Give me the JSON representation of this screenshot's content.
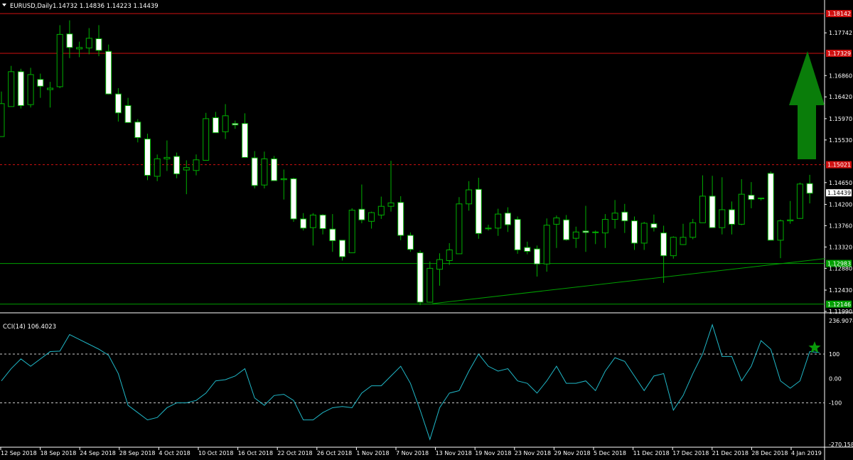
{
  "header": {
    "symbol": "EURUSD,Daily",
    "ohlc": "1.14732 1.14836 1.14223 1.14439"
  },
  "colors": {
    "background": "#000000",
    "bull_fill": "#000000",
    "bull_stroke": "#00b000",
    "bear_fill": "#ffffff",
    "resistance": "#d01010",
    "support": "#00a000",
    "cci_line": "#20b8c8",
    "arrow": "#0a7d0a",
    "star": "#0a9a0a"
  },
  "icons": {
    "arrow": "up-arrow-icon",
    "star": "star-icon",
    "menu": "triangle-down-icon"
  },
  "chart_data": [
    {
      "type": "candlestick",
      "ylim": [
        1.1199,
        1.182
      ],
      "price_ticks": [
        "1.17742",
        "1.16860",
        "1.16420",
        "1.15970",
        "1.15530",
        "1.14650",
        "1.14200",
        "1.13760",
        "1.13320",
        "1.12880",
        "1.12430",
        "1.11990"
      ],
      "x_labels": [
        "12 Sep 2018",
        "18 Sep 2018",
        "24 Sep 2018",
        "28 Sep 2018",
        "4 Oct 2018",
        "10 Oct 2018",
        "16 Oct 2018",
        "22 Oct 2018",
        "26 Oct 2018",
        "1 Nov 2018",
        "7 Nov 2018",
        "13 Nov 2018",
        "19 Nov 2018",
        "23 Nov 2018",
        "29 Nov 2018",
        "5 Dec 2018",
        "11 Dec 2018",
        "17 Dec 2018",
        "21 Dec 2018",
        "28 Dec 2018",
        "4 Jan 2019"
      ],
      "current_price": "1.14439",
      "horizontal_levels": [
        {
          "value": 1.1814,
          "label": "1.18142",
          "color": "#d01010",
          "style": "solid"
        },
        {
          "value": 1.1732,
          "label": "1.17329",
          "color": "#d01010",
          "style": "solid"
        },
        {
          "value": 1.1502,
          "label": "1.15021",
          "color": "#d01010",
          "style": "dashed"
        },
        {
          "value": 1.1298,
          "label": "1.12983",
          "color": "#00a000",
          "style": "solid"
        },
        {
          "value": 1.1214,
          "label": "1.12146",
          "color": "#00a000",
          "style": "solid"
        }
      ],
      "trendline": {
        "from": [
          1.1215
        ],
        "to": [
          1.1308
        ]
      },
      "candles": [
        [
          1.156,
          1.1653,
          1.1583,
          1.1628
        ],
        [
          1.1622,
          1.1706,
          1.1627,
          1.1694
        ],
        [
          1.1694,
          1.17,
          1.1618,
          1.1624
        ],
        [
          1.1626,
          1.1702,
          1.162,
          1.1688
        ],
        [
          1.1678,
          1.169,
          1.164,
          1.1664
        ],
        [
          1.1657,
          1.1673,
          1.162,
          1.166
        ],
        [
          1.1663,
          1.179,
          1.166,
          1.1771
        ],
        [
          1.1772,
          1.18,
          1.1722,
          1.1744
        ],
        [
          1.1741,
          1.1756,
          1.1724,
          1.1744
        ],
        [
          1.1743,
          1.1784,
          1.173,
          1.1763
        ],
        [
          1.1762,
          1.179,
          1.1726,
          1.1738
        ],
        [
          1.1736,
          1.175,
          1.1647,
          1.1648
        ],
        [
          1.1648,
          1.166,
          1.1591,
          1.1609
        ],
        [
          1.1624,
          1.164,
          1.1588,
          1.1589
        ],
        [
          1.159,
          1.1596,
          1.1548,
          1.1558
        ],
        [
          1.1555,
          1.1566,
          1.147,
          1.148
        ],
        [
          1.1478,
          1.1523,
          1.1468,
          1.1514
        ],
        [
          1.1514,
          1.1552,
          1.1489,
          1.1517
        ],
        [
          1.1519,
          1.1527,
          1.1474,
          1.1483
        ],
        [
          1.1491,
          1.1511,
          1.1441,
          1.1496
        ],
        [
          1.149,
          1.1523,
          1.148,
          1.1512
        ],
        [
          1.1511,
          1.1609,
          1.1511,
          1.1597
        ],
        [
          1.1599,
          1.1611,
          1.1568,
          1.1568
        ],
        [
          1.157,
          1.1627,
          1.1555,
          1.1603
        ],
        [
          1.1587,
          1.1593,
          1.1576,
          1.1584
        ],
        [
          1.1587,
          1.1608,
          1.1517,
          1.1517
        ],
        [
          1.1516,
          1.153,
          1.1453,
          1.1459
        ],
        [
          1.146,
          1.1529,
          1.1453,
          1.1514
        ],
        [
          1.1514,
          1.152,
          1.1469,
          1.1469
        ],
        [
          1.1471,
          1.1492,
          1.143,
          1.1473
        ],
        [
          1.1473,
          1.1475,
          1.1384,
          1.139
        ],
        [
          1.139,
          1.1402,
          1.1366,
          1.1371
        ],
        [
          1.1372,
          1.1402,
          1.1335,
          1.1398
        ],
        [
          1.1398,
          1.14,
          1.1358,
          1.137
        ],
        [
          1.1369,
          1.14,
          1.1322,
          1.1345
        ],
        [
          1.1346,
          1.1346,
          1.1304,
          1.1312
        ],
        [
          1.132,
          1.1412,
          1.132,
          1.1408
        ],
        [
          1.141,
          1.1461,
          1.1381,
          1.1388
        ],
        [
          1.1385,
          1.1405,
          1.137,
          1.1403
        ],
        [
          1.1398,
          1.1436,
          1.139,
          1.1416
        ],
        [
          1.1416,
          1.151,
          1.1405,
          1.1423
        ],
        [
          1.1424,
          1.1437,
          1.1346,
          1.1356
        ],
        [
          1.1356,
          1.1362,
          1.1322,
          1.1327
        ],
        [
          1.132,
          1.1325,
          1.1212,
          1.1218
        ],
        [
          1.1218,
          1.1302,
          1.1217,
          1.1288
        ],
        [
          1.1286,
          1.1319,
          1.1252,
          1.1306
        ],
        [
          1.1304,
          1.134,
          1.1295,
          1.1326
        ],
        [
          1.1318,
          1.1435,
          1.1318,
          1.1421
        ],
        [
          1.1421,
          1.1468,
          1.1407,
          1.145
        ],
        [
          1.1451,
          1.1475,
          1.1349,
          1.136
        ],
        [
          1.1371,
          1.1378,
          1.1366,
          1.137
        ],
        [
          1.1371,
          1.1411,
          1.1355,
          1.14
        ],
        [
          1.1402,
          1.1414,
          1.1363,
          1.1378
        ],
        [
          1.1389,
          1.1395,
          1.1318,
          1.1326
        ],
        [
          1.1331,
          1.1343,
          1.1317,
          1.1323
        ],
        [
          1.1328,
          1.1335,
          1.1271,
          1.1297
        ],
        [
          1.1297,
          1.1391,
          1.1281,
          1.1377
        ],
        [
          1.1379,
          1.1397,
          1.133,
          1.1392
        ],
        [
          1.1388,
          1.1398,
          1.1345,
          1.1347
        ],
        [
          1.135,
          1.1374,
          1.133,
          1.1363
        ],
        [
          1.1365,
          1.1417,
          1.1322,
          1.1362
        ],
        [
          1.1362,
          1.1366,
          1.1338,
          1.1363
        ],
        [
          1.1361,
          1.14,
          1.133,
          1.1389
        ],
        [
          1.1389,
          1.1429,
          1.137,
          1.1402
        ],
        [
          1.1404,
          1.1421,
          1.1361,
          1.1386
        ],
        [
          1.1386,
          1.1395,
          1.1326,
          1.134
        ],
        [
          1.134,
          1.1384,
          1.1326,
          1.1381
        ],
        [
          1.138,
          1.1399,
          1.1364,
          1.1372
        ],
        [
          1.1361,
          1.1376,
          1.1258,
          1.1314
        ],
        [
          1.1314,
          1.1354,
          1.1308,
          1.1352
        ],
        [
          1.1337,
          1.138,
          1.1336,
          1.1352
        ],
        [
          1.1352,
          1.139,
          1.1348,
          1.1382
        ],
        [
          1.1382,
          1.148,
          1.1382,
          1.1437
        ],
        [
          1.1437,
          1.1479,
          1.1372,
          1.1372
        ],
        [
          1.1372,
          1.1476,
          1.1358,
          1.1409
        ],
        [
          1.1409,
          1.1426,
          1.1358,
          1.1379
        ],
        [
          1.1379,
          1.1472,
          1.1377,
          1.1441
        ],
        [
          1.1439,
          1.1466,
          1.1412,
          1.143
        ],
        [
          1.1432,
          1.1431,
          1.1428,
          1.1433
        ],
        [
          1.1484,
          1.1488,
          1.1346,
          1.1346
        ],
        [
          1.1346,
          1.1389,
          1.1309,
          1.1386
        ],
        [
          1.1386,
          1.1427,
          1.138,
          1.1388
        ],
        [
          1.1391,
          1.1465,
          1.139,
          1.1462
        ],
        [
          1.1463,
          1.1481,
          1.1422,
          1.1443
        ]
      ]
    },
    {
      "type": "line",
      "name": "CCI(14) 106.4023",
      "ylim": [
        -270.1582,
        236.9078
      ],
      "y_ticks": [
        "236.9078",
        "100",
        "0.00",
        "-100",
        "-270.1582"
      ],
      "levels": [
        100,
        -100
      ],
      "values": [
        -10,
        40,
        80,
        50,
        80,
        110,
        112,
        180,
        160,
        140,
        120,
        95,
        20,
        -110,
        -140,
        -170,
        -160,
        -120,
        -100,
        -100,
        -90,
        -60,
        -10,
        -5,
        10,
        40,
        -80,
        -110,
        -70,
        -65,
        -90,
        -170,
        -170,
        -140,
        -120,
        -115,
        -120,
        -60,
        -30,
        -30,
        10,
        50,
        -20,
        -130,
        -250,
        -120,
        -60,
        -50,
        30,
        100,
        50,
        30,
        40,
        -10,
        -20,
        -60,
        -10,
        50,
        -20,
        -20,
        -10,
        -50,
        30,
        85,
        70,
        10,
        -50,
        10,
        20,
        -130,
        -70,
        20,
        100,
        220,
        90,
        90,
        -10,
        50,
        155,
        120,
        -10,
        -40,
        -10,
        110,
        106
      ]
    }
  ]
}
